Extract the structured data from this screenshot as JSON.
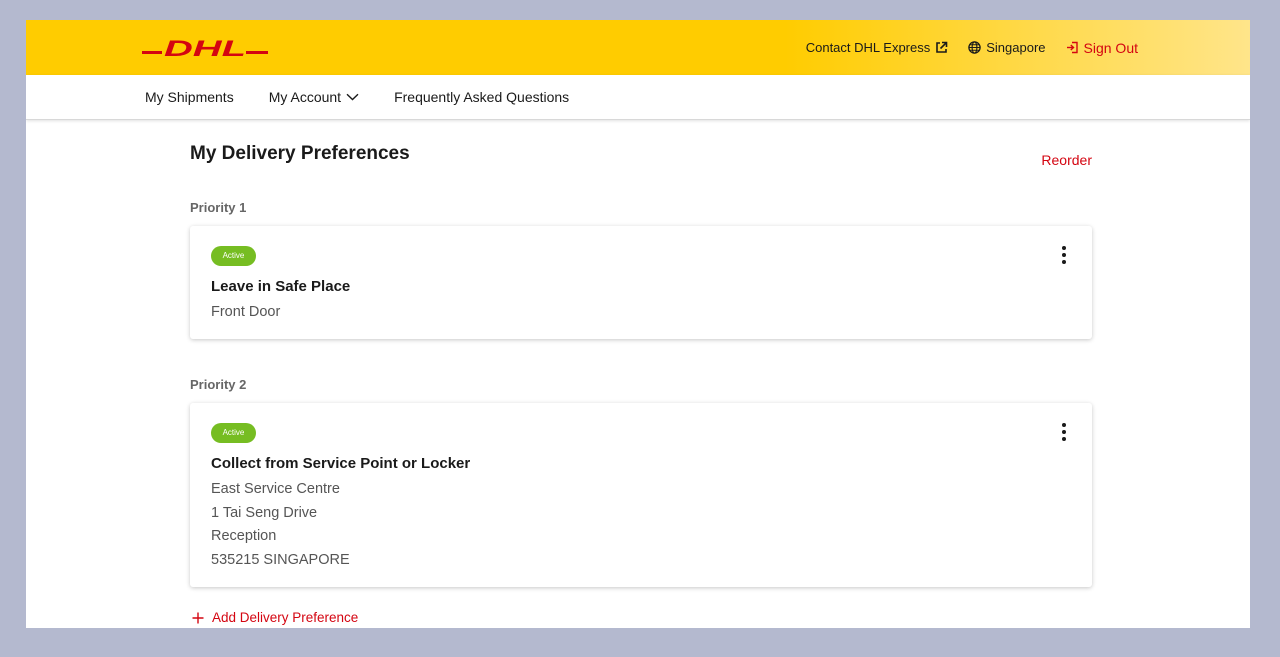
{
  "brand": {
    "logo_text": "DHL",
    "color_primary": "#ffcc00",
    "color_red": "#d40511"
  },
  "header": {
    "contact_label": "Contact DHL Express",
    "country_label": "Singapore",
    "signout_label": "Sign Out"
  },
  "nav": {
    "items": [
      {
        "label": "My Shipments"
      },
      {
        "label": "My Account"
      },
      {
        "label": "Frequently Asked Questions"
      }
    ]
  },
  "page": {
    "title": "My Delivery Preferences",
    "reorder_label": "Reorder",
    "add_label": "Add Delivery Preference"
  },
  "preferences": [
    {
      "priority": "Priority 1",
      "status": "Active",
      "title": "Leave in Safe Place",
      "lines": [
        "Front Door"
      ]
    },
    {
      "priority": "Priority 2",
      "status": "Active",
      "title": "Collect from Service Point or Locker",
      "lines": [
        "East Service Centre",
        "1 Tai Seng Drive",
        "Reception",
        "535215 SINGAPORE"
      ]
    }
  ],
  "colors": {
    "badge_active": "#76bd22",
    "background": "#b4b9cf"
  }
}
